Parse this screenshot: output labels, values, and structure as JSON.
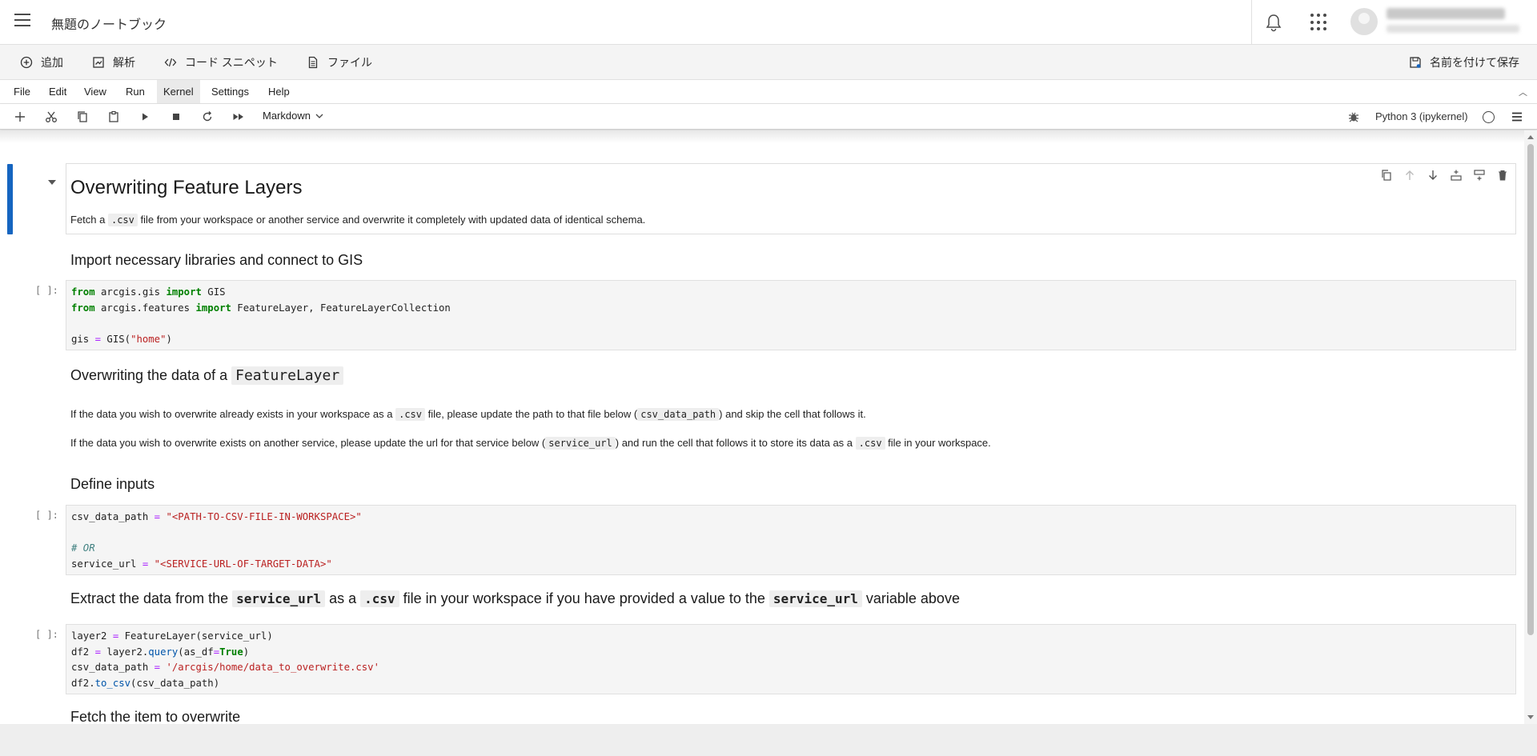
{
  "header": {
    "title": "無題のノートブック",
    "icons": [
      "menu-icon",
      "bell-icon",
      "apps-grid-icon",
      "user-avatar-icon"
    ]
  },
  "actionbar": {
    "add_label": "追加",
    "analysis_label": "解析",
    "snippets_label": "コード スニペット",
    "files_label": "ファイル",
    "save_as_label": "名前を付けて保存"
  },
  "menubar": {
    "items": [
      "File",
      "Edit",
      "View",
      "Run",
      "Kernel",
      "Settings",
      "Help"
    ],
    "active": "Kernel"
  },
  "toolbar": {
    "cell_type": "Markdown",
    "kernel_name": "Python 3 (ipykernel)",
    "icons": [
      "add-cell-icon",
      "cut-icon",
      "copy-icon",
      "paste-icon",
      "run-icon",
      "stop-icon",
      "restart-icon",
      "run-all-icon",
      "debugger-icon",
      "kernel-status-icon",
      "more-icon"
    ]
  },
  "notebook": {
    "h1": "Overwriting Feature Layers",
    "intro": {
      "before": "Fetch a ",
      "code": ".csv",
      "after": " file from your workspace or another service and overwrite it completely with updated data of identical schema."
    },
    "sec1_heading": "Import necessary libraries and connect to GIS",
    "prompt": "[ ]:",
    "code1": {
      "l1a": "from",
      "l1b": " arcgis.gis ",
      "l1c": "import",
      "l1d": " GIS",
      "l2a": "from",
      "l2b": " arcgis.features ",
      "l2c": "import",
      "l2d": " FeatureLayer, FeatureLayerCollection",
      "l4a": "gis ",
      "l4b": "=",
      "l4c": " GIS(",
      "l4d": "\"home\"",
      "l4e": ")"
    },
    "sec2_heading": {
      "before": "Overwriting the data of a ",
      "code": "FeatureLayer"
    },
    "para1": {
      "a": "If the data you wish to overwrite already exists in your workspace as a ",
      "b": ".csv",
      "c": " file, please update the path to that file below (",
      "d": "csv_data_path",
      "e": ") and skip the cell that follows it."
    },
    "para2": {
      "a": "If the data you wish to overwrite exists on another service, please update the url for that service below (",
      "b": "service_url",
      "c": ") and run the cell that follows it to store its data as a ",
      "d": ".csv",
      "e": " file in your workspace."
    },
    "sec3_heading": "Define inputs",
    "code2": {
      "l1a": "csv_data_path ",
      "l1b": "=",
      "l1c": " ",
      "l1d": "\"<PATH-TO-CSV-FILE-IN-WORKSPACE>\"",
      "l3": "# OR",
      "l4a": "service_url ",
      "l4b": "=",
      "l4c": " ",
      "l4d": "\"<SERVICE-URL-OF-TARGET-DATA>\""
    },
    "sec4_heading": {
      "a": "Extract the data from the ",
      "b": "service_url",
      "c": " as a ",
      "d": ".csv",
      "e": " file in your workspace if you have provided a value to the ",
      "f": "service_url",
      "g": " variable above"
    },
    "code3": {
      "l1a": "layer2 ",
      "l1b": "=",
      "l1c": " FeatureLayer(service_url)",
      "l2a": "df2 ",
      "l2b": "=",
      "l2c": " layer2.",
      "l2d": "query",
      "l2e": "(as_df",
      "l2f": "=",
      "l2g": "True",
      "l2h": ")",
      "l3a": "csv_data_path ",
      "l3b": "=",
      "l3c": " ",
      "l3d": "'/arcgis/home/data_to_overwrite.csv'",
      "l4a": "df2.",
      "l4b": "to_csv",
      "l4c": "(csv_data_path)"
    },
    "sec5_heading": "Fetch the item to overwrite"
  },
  "colors": {
    "accent_selection": "#1565c0",
    "keyword": "#008000",
    "string": "#ba2121",
    "operator": "#aa22ff",
    "comment": "#408080"
  }
}
